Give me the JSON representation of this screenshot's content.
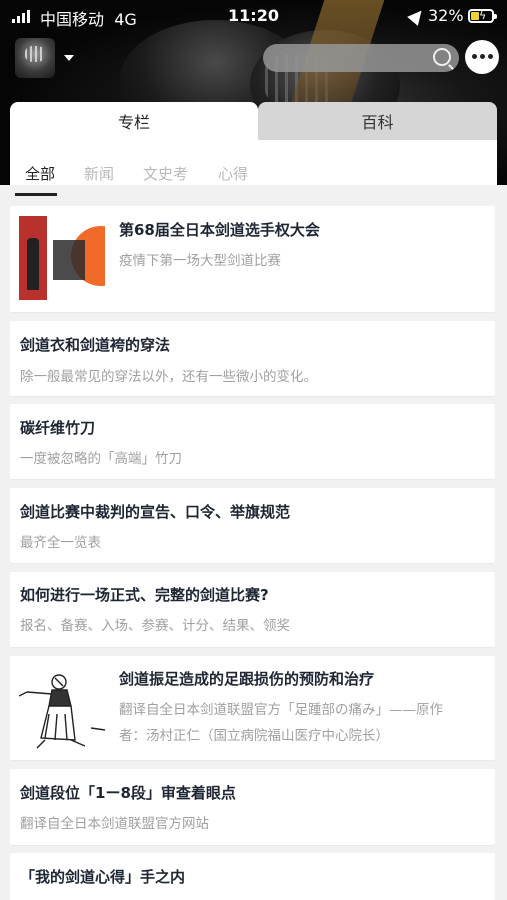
{
  "status_bar": {
    "carrier": "中国移动",
    "network": "4G",
    "time": "11:20",
    "battery": "32%"
  },
  "search": {
    "placeholder": ""
  },
  "main_tabs": [
    {
      "label": "专栏",
      "active": true
    },
    {
      "label": "百科",
      "active": false
    }
  ],
  "sub_tabs": [
    {
      "label": "全部",
      "active": true
    },
    {
      "label": "新闻",
      "active": false
    },
    {
      "label": "文史考",
      "active": false
    },
    {
      "label": "心得",
      "active": false
    }
  ],
  "articles": [
    {
      "title": "第68届全日本剑道选手权大会",
      "desc": "疫情下第一场大型剑道比赛",
      "thumbnail": "tournament-poster"
    },
    {
      "title": "剑道衣和剑道袴的穿法",
      "desc": "除一般最常见的穿法以外，还有一些微小的变化。"
    },
    {
      "title": "碳纤维竹刀",
      "desc": "一度被忽略的「高端」竹刀"
    },
    {
      "title": "剑道比赛中裁判的宣告、口令、举旗规范",
      "desc": "最齐全一览表"
    },
    {
      "title": "如何进行一场正式、完整的剑道比赛?",
      "desc": "报名、备赛、入场、参赛、计分、结果、领奖"
    },
    {
      "title": "剑道振足造成的足跟损伤的预防和治疗",
      "desc": "翻译自全日本剑道联盟官方「足踵部の痛み」——原作",
      "desc2": "者：汤村正仁（国立病院福山医疗中心院长）",
      "thumbnail": "kendo-sketch"
    },
    {
      "title": "剑道段位「1ー8段」审查着眼点",
      "desc": "翻译自全日本剑道联盟官方网站"
    },
    {
      "title": "「我的剑道心得」手之内",
      "desc": ""
    }
  ],
  "colors": {
    "title": "#1f2633",
    "desc": "#a0a0a0",
    "background": "#f1f1f1",
    "battery": "#f2d233"
  }
}
